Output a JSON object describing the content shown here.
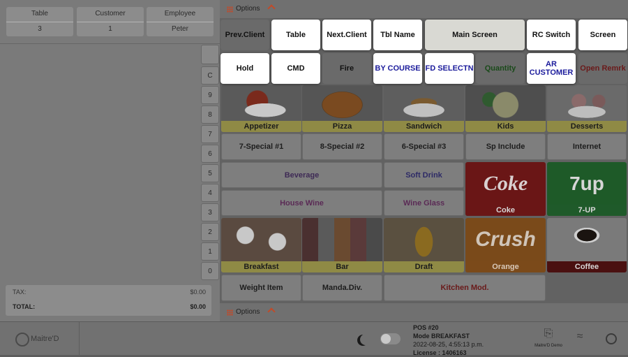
{
  "header": {
    "cells": [
      {
        "label": "Table",
        "value": "3"
      },
      {
        "label": "Customer",
        "value": "1"
      },
      {
        "label": "Employee",
        "value": "Peter"
      }
    ]
  },
  "numpad": [
    "C",
    "9",
    "8",
    "7",
    "6",
    "5",
    "4",
    "3",
    "2",
    "1",
    "0"
  ],
  "totals": {
    "tax_label": "TAX:",
    "tax_value": "$0.00",
    "total_label": "TOTAL:",
    "total_value": "$0.00"
  },
  "options": {
    "label": "Options",
    "label_bottom": "Options"
  },
  "popup": {
    "row1": [
      "Prev.Client",
      "Table",
      "Next.Client",
      "Tbl Name",
      "Main Screen",
      "RC Switch",
      "Screen"
    ],
    "row2": [
      "Hold",
      "CMD",
      "Fire",
      "BY COURSE",
      "FD SELECTN",
      "Quantity",
      "AR CUSTOMER",
      "Open Remrk"
    ]
  },
  "food_row1": [
    "Appetizer",
    "Pizza",
    "Sandwich",
    "Kids",
    "Desserts"
  ],
  "specials": [
    "7-Special #1",
    "8-Special #2",
    "6-Special #3",
    "Sp Include",
    "Internet"
  ],
  "beverage": {
    "beverage": "Beverage",
    "soft_drink": "Soft Drink",
    "house_wine": "House Wine",
    "wine_glass": "Wine Glass"
  },
  "drinks": {
    "coke": "Coke",
    "coke_logo": "Coke",
    "sevenup": "7-UP",
    "sevenup_logo": "7up"
  },
  "food_row3": [
    "Breakfast",
    "Bar",
    "Draft",
    "Orange",
    "Coffee"
  ],
  "orange_logo": "Crush",
  "bottom_tiles": {
    "weight": "Weight Item",
    "manda": "Manda.Div.",
    "kitchen": "Kitchen Mod."
  },
  "footer": {
    "logo": "Maitre'D",
    "pos": "POS #20",
    "mode": "Mode BREAKFAST",
    "datetime": "2022-08-25, 4:55:13 p.m.",
    "license": "License : 1406163",
    "demo": "Maitre'D Demo"
  }
}
